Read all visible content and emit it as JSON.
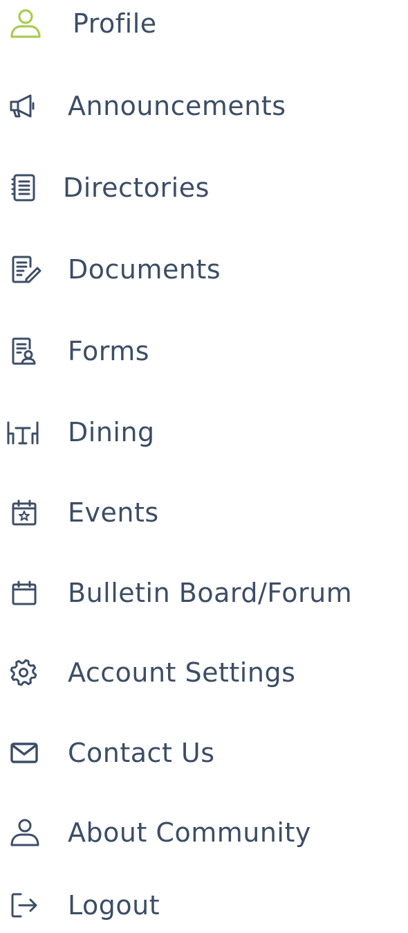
{
  "colors": {
    "text": "#3c4d66",
    "icon": "#3c4d66",
    "active_icon": "#a8cc52",
    "background": "#ffffff"
  },
  "menu": {
    "items": [
      {
        "label": "Profile",
        "icon": "user-icon",
        "active": true
      },
      {
        "label": "Announcements",
        "icon": "megaphone-icon",
        "active": false
      },
      {
        "label": "Directories",
        "icon": "list-document-icon",
        "active": false
      },
      {
        "label": "Documents",
        "icon": "document-edit-icon",
        "active": false
      },
      {
        "label": "Forms",
        "icon": "form-user-icon",
        "active": false
      },
      {
        "label": "Dining",
        "icon": "dining-table-icon",
        "active": false
      },
      {
        "label": "Events",
        "icon": "calendar-star-icon",
        "active": false
      },
      {
        "label": "Bulletin Board/Forum",
        "icon": "calendar-board-icon",
        "active": false
      },
      {
        "label": "Account Settings",
        "icon": "gear-icon",
        "active": false
      },
      {
        "label": "Contact Us",
        "icon": "envelope-icon",
        "active": false
      },
      {
        "label": "About Community",
        "icon": "person-outline-icon",
        "active": false
      },
      {
        "label": "Logout",
        "icon": "logout-icon",
        "active": false
      }
    ]
  }
}
